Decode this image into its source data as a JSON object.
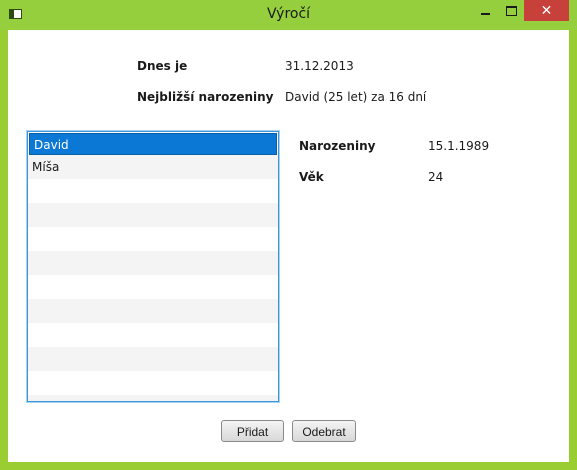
{
  "window": {
    "title": "Výročí"
  },
  "summary": {
    "today_label": "Dnes je",
    "today_value": "31.12.2013",
    "next_birthday_label": "Nejbližší narozeniny",
    "next_birthday_value": "David (25 let) za 16 dní"
  },
  "people_list": {
    "items": [
      "David",
      "Míša"
    ],
    "selected": "David"
  },
  "detail": {
    "birthday_label": "Narozeniny",
    "birthday_value": "15.1.1989",
    "age_label": "Věk",
    "age_value": "24"
  },
  "actions": {
    "add_label": "Přidat",
    "remove_label": "Odebrat"
  },
  "colors": {
    "titlebar": "#95cf3e",
    "close_button": "#c7403a",
    "selection": "#0a78d4"
  }
}
